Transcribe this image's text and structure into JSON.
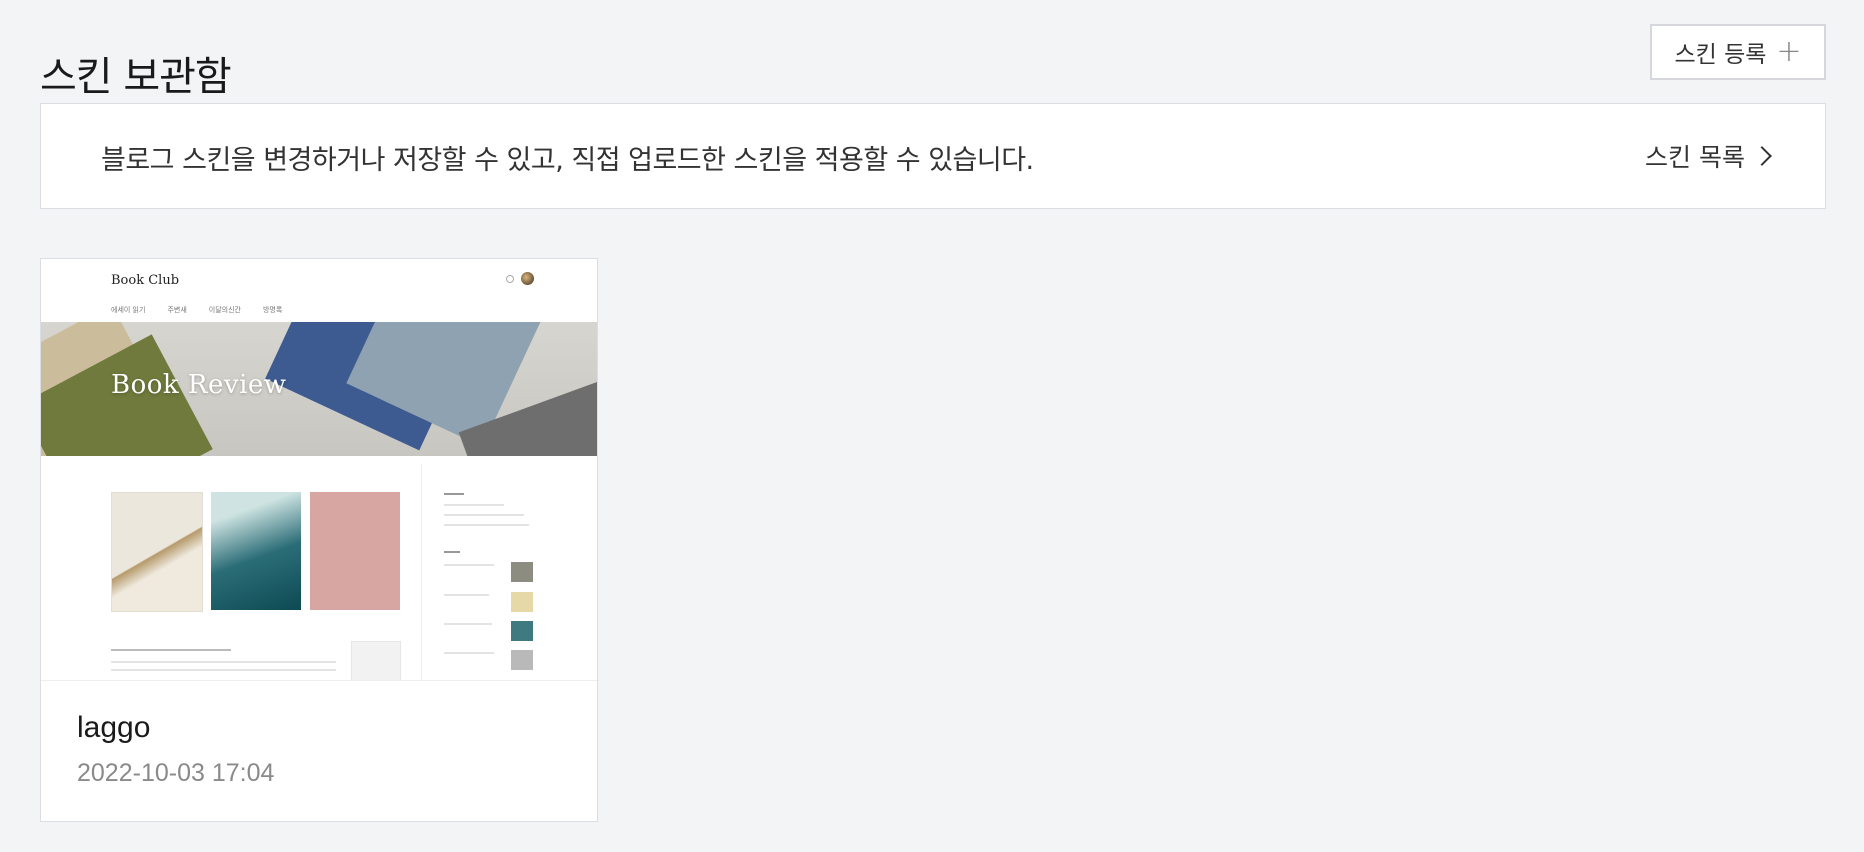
{
  "header": {
    "title": "스킨 보관함",
    "register_label": "스킨 등록",
    "register_icon": "plus-icon"
  },
  "banner": {
    "text": "블로그 스킨을 변경하거나 저장할 수 있고, 직접 업로드한 스킨을 적용할 수 있습니다.",
    "link_label": "스킨 목록",
    "link_icon": "chevron-right-icon"
  },
  "skins": [
    {
      "name": "laggo",
      "date": "2022-10-03 17:04",
      "preview": {
        "logo": "Book Club",
        "hero_title": "Book Review",
        "nav_items": [
          "에세이 읽기",
          "주변새",
          "이달의신간",
          "방명록"
        ]
      }
    }
  ],
  "colors": {
    "background": "#f3f4f6",
    "card": "#ffffff",
    "border": "#dadde2",
    "muted_text": "#8a8a8a"
  }
}
